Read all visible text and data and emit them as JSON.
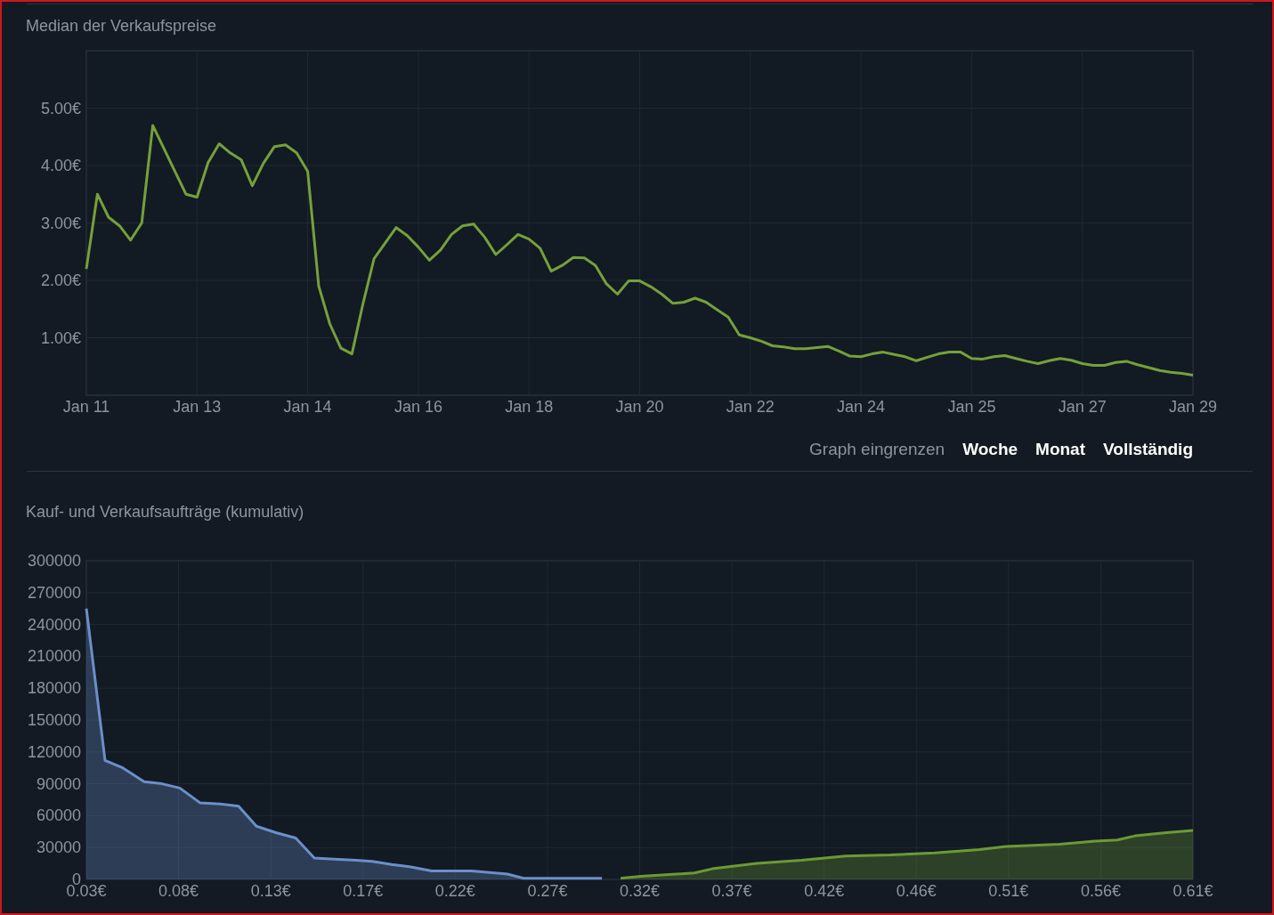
{
  "price_history": {
    "title": "Median der Verkaufspreise",
    "chart_data": {
      "type": "line",
      "categories": [
        "Jan 11",
        null,
        null,
        null,
        null,
        null,
        null,
        null,
        null,
        null,
        "Jan 13",
        null,
        null,
        null,
        null,
        null,
        null,
        null,
        null,
        null,
        "Jan 14",
        null,
        null,
        null,
        null,
        null,
        null,
        null,
        null,
        null,
        "Jan 16",
        null,
        null,
        null,
        null,
        null,
        null,
        null,
        null,
        null,
        "Jan 18",
        null,
        null,
        null,
        null,
        null,
        null,
        null,
        null,
        null,
        "Jan 20",
        null,
        null,
        null,
        null,
        null,
        null,
        null,
        null,
        null,
        "Jan 22",
        null,
        null,
        null,
        null,
        null,
        null,
        null,
        null,
        null,
        "Jan 24",
        null,
        null,
        null,
        null,
        null,
        null,
        null,
        null,
        null,
        "Jan 25",
        null,
        null,
        null,
        null,
        null,
        null,
        null,
        null,
        null,
        "Jan 27",
        null,
        null,
        null,
        null,
        null,
        null,
        null,
        null,
        null,
        "Jan 29"
      ],
      "series": [
        {
          "color": "#76a03b",
          "values": [
            2.2,
            3.5,
            3.1,
            2.95,
            2.7,
            3.0,
            4.7,
            4.3,
            3.9,
            3.5,
            3.45,
            4.05,
            4.38,
            4.22,
            4.1,
            3.65,
            4.04,
            4.33,
            4.36,
            4.22,
            3.9,
            1.9,
            1.24,
            0.82,
            0.72,
            1.6,
            2.38,
            2.65,
            2.92,
            2.78,
            2.58,
            2.35,
            2.53,
            2.8,
            2.95,
            2.98,
            2.75,
            2.45,
            2.62,
            2.8,
            2.72,
            2.56,
            2.16,
            2.26,
            2.4,
            2.39,
            2.26,
            1.94,
            1.76,
            1.99,
            1.99,
            1.89,
            1.76,
            1.6,
            1.62,
            1.69,
            1.62,
            1.49,
            1.36,
            1.05,
            1.0,
            0.94,
            0.86,
            0.84,
            0.81,
            0.81,
            0.83,
            0.85,
            0.77,
            0.68,
            0.67,
            0.72,
            0.75,
            0.71,
            0.67,
            0.6,
            0.66,
            0.72,
            0.75,
            0.75,
            0.64,
            0.63,
            0.67,
            0.69,
            0.64,
            0.59,
            0.55,
            0.6,
            0.64,
            0.61,
            0.55,
            0.52,
            0.52,
            0.57,
            0.59,
            0.53,
            0.48,
            0.43,
            0.4,
            0.38,
            0.35
          ]
        }
      ],
      "ylim": [
        0,
        6
      ],
      "grid": true,
      "yticks": [
        {
          "value": 1,
          "label": "1.00€"
        },
        {
          "value": 2,
          "label": "2.00€"
        },
        {
          "value": 3,
          "label": "3.00€"
        },
        {
          "value": 4,
          "label": "4.00€"
        },
        {
          "value": 5,
          "label": "5.00€"
        }
      ]
    }
  },
  "zoom_controls": {
    "label": "Graph eingrenzen",
    "options": [
      {
        "label": "Woche"
      },
      {
        "label": "Monat"
      },
      {
        "label": "Vollständig"
      }
    ]
  },
  "order_book": {
    "title": "Kauf- und Verkaufsaufträge (kumulativ)",
    "chart_data": {
      "type": "area",
      "x": [
        0.03,
        0.0398,
        0.0491,
        0.0603,
        0.0697,
        0.079,
        0.0897,
        0.1,
        0.1098,
        0.1191,
        0.1294,
        0.1397,
        0.1495,
        0.1597,
        0.1714,
        0.1798,
        0.19,
        0.1994,
        0.211,
        0.232,
        0.2507,
        0.2591,
        0.3002,
        0.31,
        0.3207,
        0.3487,
        0.358,
        0.3813,
        0.4047,
        0.428,
        0.4513,
        0.4747,
        0.498,
        0.512,
        0.54,
        0.5587,
        0.5703,
        0.5797,
        0.596,
        0.61
      ],
      "series": [
        {
          "color": "#6b8fc9",
          "values": [
            255000,
            112000,
            105000,
            92000,
            90000,
            86000,
            72000,
            71000,
            69000,
            50000,
            44000,
            39000,
            20000,
            19000,
            18000,
            17000,
            14000,
            12000,
            8000,
            8000,
            5000,
            1000,
            1000,
            null,
            null,
            null,
            null,
            null,
            null,
            null,
            null,
            null,
            null,
            null,
            null,
            null,
            null,
            null,
            null,
            null
          ]
        },
        {
          "color": "#6c9a34",
          "values": [
            null,
            null,
            null,
            null,
            null,
            null,
            null,
            null,
            null,
            null,
            null,
            null,
            null,
            null,
            null,
            null,
            null,
            null,
            null,
            null,
            null,
            null,
            null,
            1000,
            3000,
            6000,
            10000,
            15000,
            18000,
            22000,
            23000,
            25000,
            28000,
            31000,
            33000,
            36000,
            37000,
            41000,
            44000,
            46000
          ]
        }
      ],
      "xlim": [
        0.03,
        0.61
      ],
      "ylim": [
        0,
        300000
      ],
      "grid": true,
      "xticks": [
        {
          "value": 0.03,
          "label": "0.03€"
        },
        {
          "value": 0.0783,
          "label": "0.08€"
        },
        {
          "value": 0.1267,
          "label": "0.13€"
        },
        {
          "value": 0.175,
          "label": "0.17€"
        },
        {
          "value": 0.2233,
          "label": "0.22€"
        },
        {
          "value": 0.2717,
          "label": "0.27€"
        },
        {
          "value": 0.32,
          "label": "0.32€"
        },
        {
          "value": 0.3683,
          "label": "0.37€"
        },
        {
          "value": 0.4167,
          "label": "0.42€"
        },
        {
          "value": 0.465,
          "label": "0.46€"
        },
        {
          "value": 0.5133,
          "label": "0.51€"
        },
        {
          "value": 0.5617,
          "label": "0.56€"
        },
        {
          "value": 0.61,
          "label": "0.61€"
        }
      ],
      "yticks": [
        0,
        30000,
        60000,
        90000,
        120000,
        150000,
        180000,
        210000,
        240000,
        270000,
        300000
      ]
    }
  }
}
